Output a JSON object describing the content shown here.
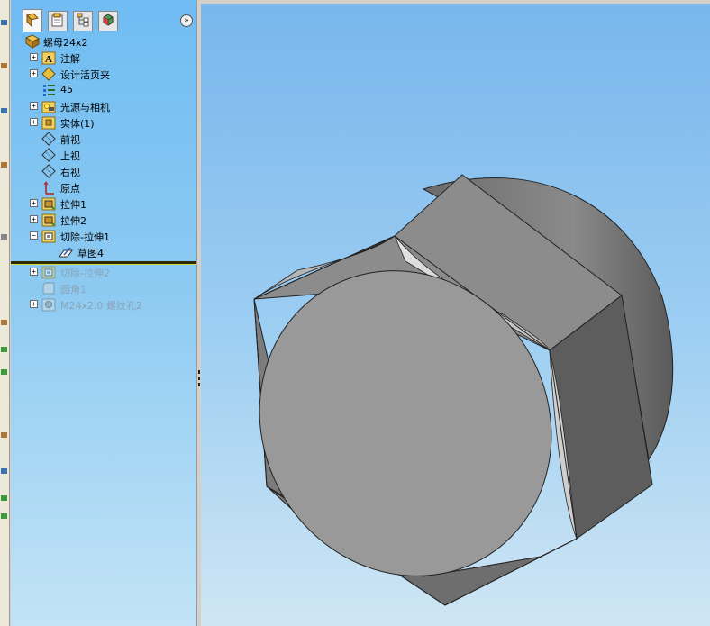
{
  "tabs": [
    {
      "name": "featuremanager-tab",
      "icon": "feature-tree-icon"
    },
    {
      "name": "propertymanager-tab",
      "icon": "property-icon"
    },
    {
      "name": "configurationmanager-tab",
      "icon": "configuration-icon"
    },
    {
      "name": "appearance-tab",
      "icon": "appearance-icon"
    }
  ],
  "collapse_label": "»",
  "tree": {
    "root": "螺母24x2",
    "items": [
      {
        "label": "注解",
        "icon": "annotation-icon",
        "expander": "+"
      },
      {
        "label": "设计活页夹",
        "icon": "design-binder-icon",
        "expander": "+"
      },
      {
        "label": "45",
        "icon": "material-icon",
        "expander": ""
      },
      {
        "label": "光源与相机",
        "icon": "lights-camera-icon",
        "expander": "+"
      },
      {
        "label": "实体(1)",
        "icon": "solid-bodies-icon",
        "expander": "+"
      },
      {
        "label": "前视",
        "icon": "plane-icon",
        "expander": ""
      },
      {
        "label": "上视",
        "icon": "plane-icon",
        "expander": ""
      },
      {
        "label": "右视",
        "icon": "plane-icon",
        "expander": ""
      },
      {
        "label": "原点",
        "icon": "origin-icon",
        "expander": ""
      },
      {
        "label": "拉伸1",
        "icon": "extrude-icon",
        "expander": "+"
      },
      {
        "label": "拉伸2",
        "icon": "extrude-icon",
        "expander": "+"
      },
      {
        "label": "切除-拉伸1",
        "icon": "cut-extrude-icon",
        "expander": "−"
      },
      {
        "label": "草图4",
        "icon": "sketch-icon",
        "expander": ""
      }
    ],
    "suppressed_items": [
      {
        "label": "切除-拉伸2",
        "icon": "cut-extrude-icon",
        "expander": "+"
      },
      {
        "label": "圆角1",
        "icon": "fillet-icon",
        "expander": ""
      },
      {
        "label": "M24x2.0 螺纹孔2",
        "icon": "hole-icon",
        "expander": "+"
      }
    ]
  },
  "colors": {
    "panel_top": "#6fbcf3",
    "viewport_top": "#78b6ec",
    "model_face": "#9a9a9a",
    "model_dark": "#5a5a5a",
    "rollback_bar": "#d8d840"
  }
}
